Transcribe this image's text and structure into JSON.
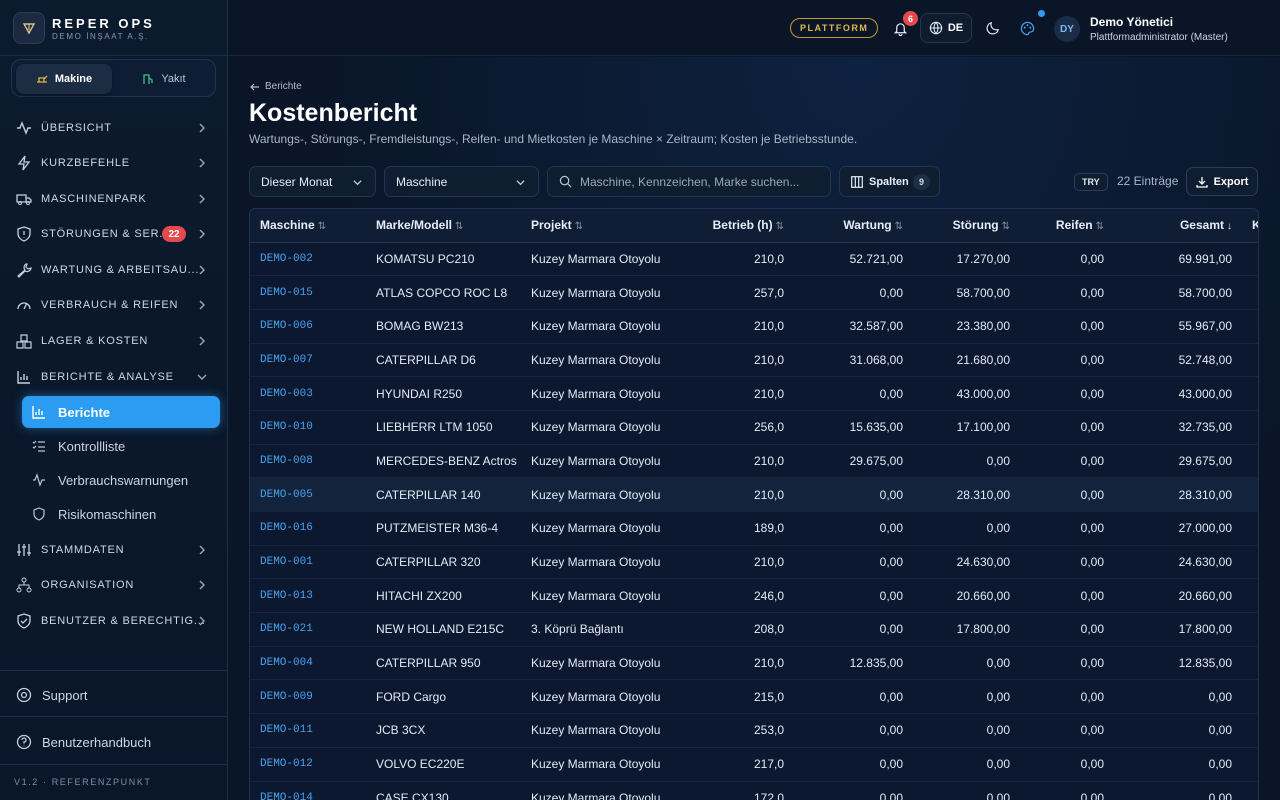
{
  "brand": {
    "title": "REPER OPS",
    "subtitle": "DEMO İNŞAAT A.Ş."
  },
  "segment": {
    "tab1": "Makine",
    "tab2": "Yakıt"
  },
  "nav": {
    "overview": "ÜBERSICHT",
    "shortcuts": "KURZBEFEHLE",
    "fleet": "MASCHINENPARK",
    "faults": "STÖRUNGEN & SER...",
    "faults_badge": "22",
    "maintenance": "WARTUNG & ARBEITSAU...",
    "consumption": "VERBRAUCH & REIFEN",
    "stock": "LAGER & KOSTEN",
    "reports": "BERICHTE & ANALYSE",
    "sub_reports": "Berichte",
    "sub_checklist": "Kontrollliste",
    "sub_warnings": "Verbrauchswarnungen",
    "sub_risk": "Risikomaschinen",
    "master": "STAMMDATEN",
    "organization": "ORGANISATION",
    "users": "BENUTZER & BERECHTIG..."
  },
  "footer": {
    "support": "Support",
    "manual": "Benutzerhandbuch",
    "version": "V1.2 · REFERENZPUNKT"
  },
  "topbar": {
    "platform": "PLATTFORM",
    "notif_count": "6",
    "lang": "DE",
    "avatar": "DY",
    "user_name": "Demo Yönetici",
    "user_role": "Plattformadministrator (Master)"
  },
  "page": {
    "back": "Berichte",
    "title": "Kostenbericht",
    "description": "Wartungs-, Störungs-, Fremdleistungs-, Reifen- und Mietkosten je Maschine × Zeitraum; Kosten je Betriebsstunde."
  },
  "filters": {
    "period": "Dieser Monat",
    "group": "Maschine",
    "search_placeholder": "Maschine, Kennzeichen, Marke suchen...",
    "columns_label": "Spalten",
    "columns_count": "9",
    "currency": "TRY",
    "entries": "22 Einträge",
    "export": "Export"
  },
  "table": {
    "columns": [
      "Maschine",
      "Marke/Modell",
      "Projekt",
      "Betrieb (h)",
      "Wartung",
      "Störung",
      "Reifen",
      "Gesamt",
      "Koste"
    ],
    "rows": [
      [
        "DEMO-002",
        "KOMATSU PC210",
        "Kuzey Marmara Otoyolu",
        "210,0",
        "52.721,00",
        "17.270,00",
        "0,00",
        "69.991,00"
      ],
      [
        "DEMO-015",
        "ATLAS COPCO ROC L8",
        "Kuzey Marmara Otoyolu",
        "257,0",
        "0,00",
        "58.700,00",
        "0,00",
        "58.700,00"
      ],
      [
        "DEMO-006",
        "BOMAG BW213",
        "Kuzey Marmara Otoyolu",
        "210,0",
        "32.587,00",
        "23.380,00",
        "0,00",
        "55.967,00"
      ],
      [
        "DEMO-007",
        "CATERPILLAR D6",
        "Kuzey Marmara Otoyolu",
        "210,0",
        "31.068,00",
        "21.680,00",
        "0,00",
        "52.748,00"
      ],
      [
        "DEMO-003",
        "HYUNDAI R250",
        "Kuzey Marmara Otoyolu",
        "210,0",
        "0,00",
        "43.000,00",
        "0,00",
        "43.000,00"
      ],
      [
        "DEMO-010",
        "LIEBHERR LTM 1050",
        "Kuzey Marmara Otoyolu",
        "256,0",
        "15.635,00",
        "17.100,00",
        "0,00",
        "32.735,00"
      ],
      [
        "DEMO-008",
        "MERCEDES-BENZ Actros",
        "Kuzey Marmara Otoyolu",
        "210,0",
        "29.675,00",
        "0,00",
        "0,00",
        "29.675,00"
      ],
      [
        "DEMO-005",
        "CATERPILLAR 140",
        "Kuzey Marmara Otoyolu",
        "210,0",
        "0,00",
        "28.310,00",
        "0,00",
        "28.310,00"
      ],
      [
        "DEMO-016",
        "PUTZMEISTER M36-4",
        "Kuzey Marmara Otoyolu",
        "189,0",
        "0,00",
        "0,00",
        "0,00",
        "27.000,00"
      ],
      [
        "DEMO-001",
        "CATERPILLAR 320",
        "Kuzey Marmara Otoyolu",
        "210,0",
        "0,00",
        "24.630,00",
        "0,00",
        "24.630,00"
      ],
      [
        "DEMO-013",
        "HITACHI ZX200",
        "Kuzey Marmara Otoyolu",
        "246,0",
        "0,00",
        "20.660,00",
        "0,00",
        "20.660,00"
      ],
      [
        "DEMO-021",
        "NEW HOLLAND E215C",
        "3. Köprü Bağlantı",
        "208,0",
        "0,00",
        "17.800,00",
        "0,00",
        "17.800,00"
      ],
      [
        "DEMO-004",
        "CATERPILLAR 950",
        "Kuzey Marmara Otoyolu",
        "210,0",
        "12.835,00",
        "0,00",
        "0,00",
        "12.835,00"
      ],
      [
        "DEMO-009",
        "FORD Cargo",
        "Kuzey Marmara Otoyolu",
        "215,0",
        "0,00",
        "0,00",
        "0,00",
        "0,00"
      ],
      [
        "DEMO-011",
        "JCB 3CX",
        "Kuzey Marmara Otoyolu",
        "253,0",
        "0,00",
        "0,00",
        "0,00",
        "0,00"
      ],
      [
        "DEMO-012",
        "VOLVO EC220E",
        "Kuzey Marmara Otoyolu",
        "217,0",
        "0,00",
        "0,00",
        "0,00",
        "0,00"
      ],
      [
        "DEMO-014",
        "CASE CX130",
        "Kuzey Marmara Otoyolu",
        "172,0",
        "0,00",
        "0,00",
        "0,00",
        "0,00"
      ]
    ],
    "highlighted_row": 7
  },
  "colors": {
    "accent": "#2b9cf2",
    "badge": "#e5484d",
    "platform": "#e0b84a",
    "link": "#4aa3ef"
  }
}
